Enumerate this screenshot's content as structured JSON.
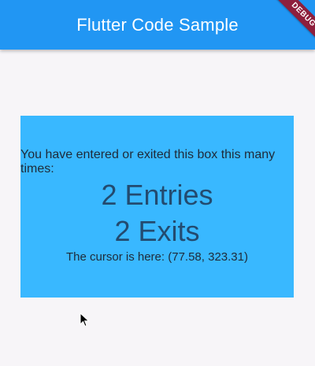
{
  "appbar": {
    "title": "Flutter Code Sample"
  },
  "debug_banner": "DEBUG",
  "mouse_region": {
    "description": "You have entered or exited this box this many times:",
    "entries": "2 Entries",
    "exits": "2 Exits",
    "cursor_text": "The cursor is here: (77.58, 323.31)"
  },
  "colors": {
    "appbar": "#2196f3",
    "box": "#39b8ff",
    "background": "#f7f5f8"
  }
}
